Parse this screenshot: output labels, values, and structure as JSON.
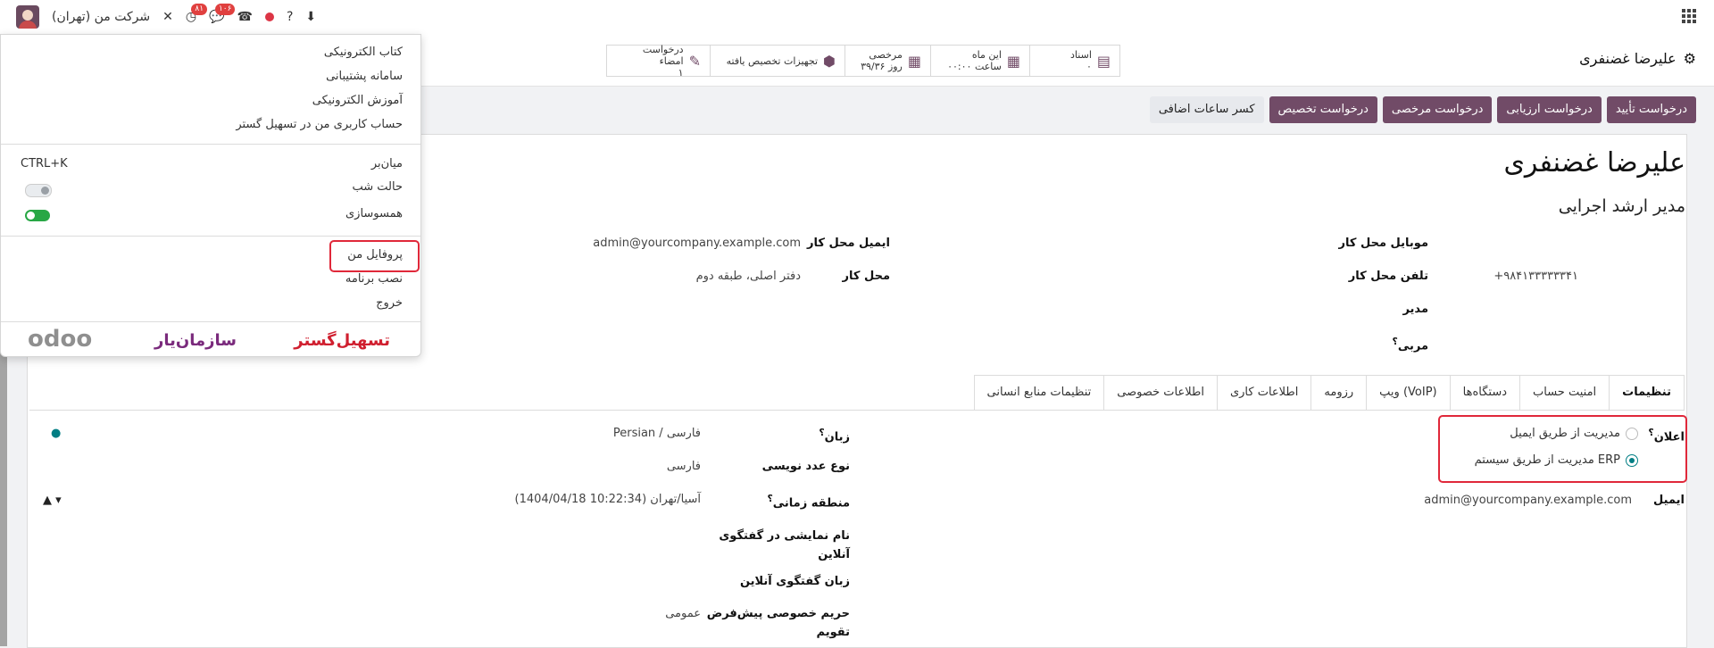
{
  "topbar": {
    "company": "شرکت من (تهران)",
    "chat_badge": "۱۰۶",
    "activity_badge": "۸۱"
  },
  "header": {
    "record_name": "علیرضا غضنفری",
    "smart_buttons": [
      {
        "label": "اسناد",
        "value": "۰",
        "icon": "document-icon"
      },
      {
        "label": "این ماه",
        "value": "۰۰:۰۰ ساعت",
        "icon": "calendar-icon"
      },
      {
        "label": "مرخصی",
        "value": "۳۹/۳۶ روز",
        "icon": "calendar-icon"
      },
      {
        "label": "تجهیزات تخصیص یافته",
        "value": "",
        "icon": "cubes-icon"
      },
      {
        "label": "درخواست امضاء",
        "value": "۱",
        "icon": "pencil-icon"
      }
    ]
  },
  "actions": [
    "درخواست تأیید",
    "درخواست ارزیابی",
    "درخواست مرخصی",
    "درخواست تخصیص",
    "کسر ساعات اضافی"
  ],
  "employee": {
    "name": "علیرضا غضنفری",
    "job": "مدیر ارشد اجرایی",
    "mobile_label": "موبایل محل کار",
    "phone_label": "تلفن محل کار",
    "phone_value": "+۹۸۴۱۳۳۳۳۳۳۴۱",
    "manager_label": "مدیر",
    "coach_label": "مربی",
    "work_email_label": "ایمیل محل کار",
    "work_email_value": "admin@yourcompany.example.com",
    "work_location_label": "محل کار",
    "work_location_value": "دفتر اصلی، طبقه دوم"
  },
  "tabs": [
    "تنظیمات",
    "امنیت حساب",
    "دستگاه‌ها",
    "ویپ (VoIP)",
    "رزومه",
    "اطلاعات کاری",
    "اطلاعات خصوصی",
    "تنظیمات منابع انسانی"
  ],
  "settings": {
    "notification_label": "اعلان",
    "notif_email": "مدیریت از طریق ایمیل",
    "notif_erp": "مدیریت از طریق سیستم ERP",
    "email_label": "ایمیل",
    "email_value": "admin@yourcompany.example.com",
    "language_label": "زبان",
    "language_value": "Persian / فارسی",
    "numeral_label": "نوع عدد نویسی",
    "numeral_value": "فارسی",
    "timezone_label": "منطقه زمانی",
    "timezone_value": "آسیا/تهران (10:22:34 1404/04/18)",
    "chat_name_label_1": "نام نمایشی در گفتگوی",
    "chat_name_label_2": "آنلاین",
    "chat_lang_label": "زبان گفتگوی آنلاین",
    "privacy_label_1": "حریم خصوصی پیش‌فرض",
    "privacy_label_2": "تقویم",
    "privacy_value": "عمومی"
  },
  "menu": {
    "items": [
      "کتاب الکترونیکی",
      "سامانه پشتیبانی",
      "آموزش الکترونیکی",
      "حساب کاربری من در تسهیل گستر"
    ],
    "shortcut_label": "میان‌بر",
    "shortcut_value": "CTRL+K",
    "dark_mode": "حالت شب",
    "sync": "همسوسازی",
    "profile": "پروفایل من",
    "install": "نصب برنامه",
    "logout": "خروج",
    "logos": [
      "تسهیل‌گستر",
      "سازمان‌یار",
      "odoo"
    ]
  },
  "colors": {
    "brand": "#714b67",
    "accent": "#017e84",
    "highlight": "#e0283a"
  }
}
